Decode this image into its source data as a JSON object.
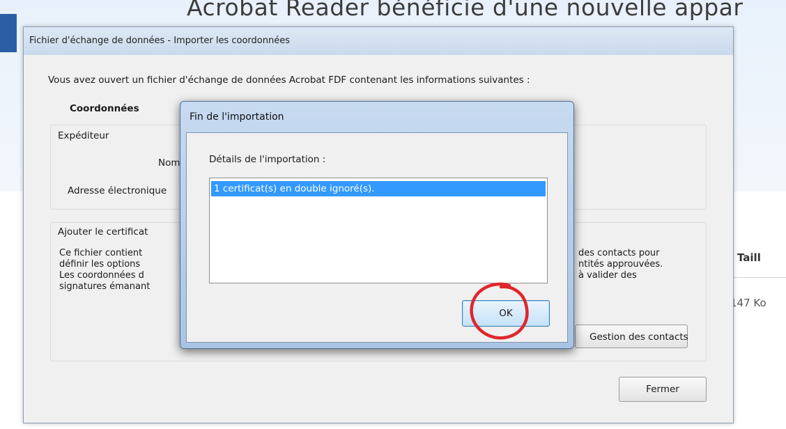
{
  "background_page": {
    "headline": "Acrobat Reader bénéficie d'une nouvelle appar",
    "column_header": "Taill",
    "column_value": "147 Ko"
  },
  "outer_dialog": {
    "title": "Fichier d'échange de données - Importer les coordonnées",
    "intro_text": "Vous avez ouvert un fichier d'échange de données Acrobat FDF contenant les informations suivantes :",
    "section_heading": "Coordonnées",
    "sender_group_label": "Expéditeur",
    "name_label": "Nom",
    "email_label": "Adresse électronique",
    "cert_group_label": "Ajouter le certificat",
    "cert_desc_left": [
      "Ce fichier contient",
      "définir les options",
      "Les coordonnées d",
      "signatures émanant"
    ],
    "cert_desc_right": [
      "des contacts pour",
      "ntités approuvées.",
      "à valider des"
    ],
    "contacts_button_label": "Gestion des contacts",
    "close_button_label": "Fermer"
  },
  "inner_dialog": {
    "title": "Fin de l'importation",
    "details_label": "Détails de l'importation :",
    "details_items": [
      "1 certificat(s) en double ignoré(s)."
    ],
    "ok_button_label": "OK"
  },
  "colors": {
    "selection": "#3399ff",
    "annotation_circle": "#e0262b",
    "accent": "#2a5fa6"
  }
}
